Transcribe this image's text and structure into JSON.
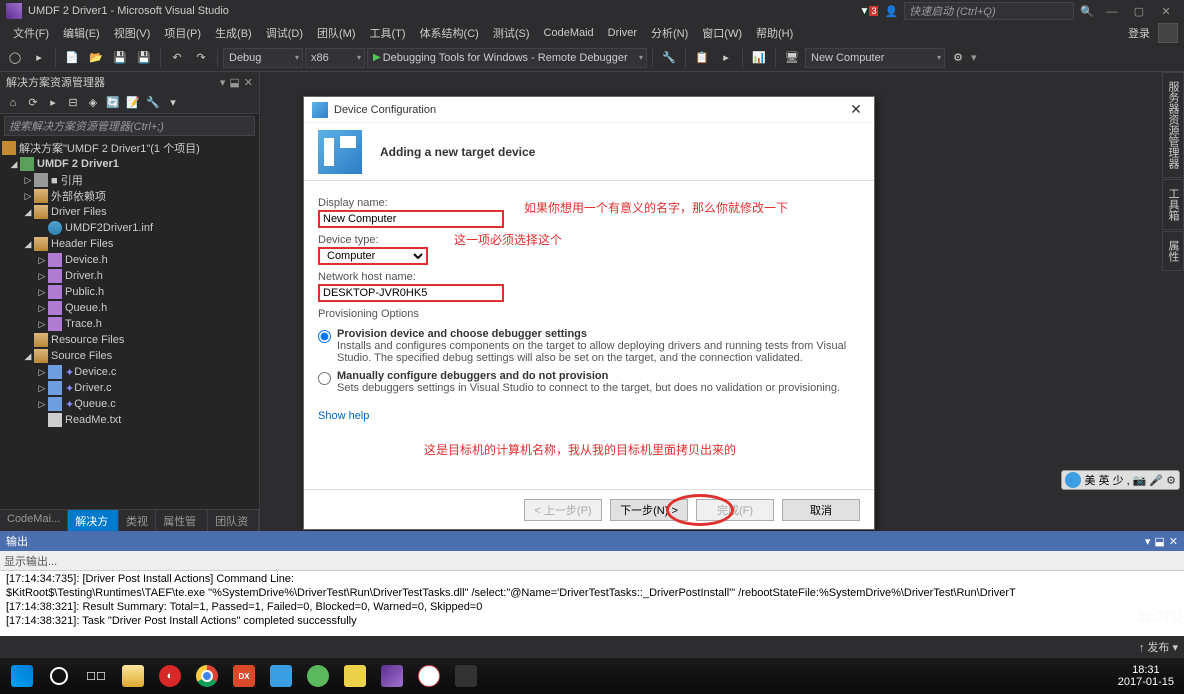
{
  "window": {
    "title": "UMDF 2 Driver1 - Microsoft Visual Studio",
    "quick_launch": "快速启动 (Ctrl+Q)",
    "login": "登录",
    "notif": "3"
  },
  "menu": [
    "文件(F)",
    "编辑(E)",
    "视图(V)",
    "项目(P)",
    "生成(B)",
    "调试(D)",
    "团队(M)",
    "工具(T)",
    "体系结构(C)",
    "测试(S)",
    "CodeMaid",
    "Driver",
    "分析(N)",
    "窗口(W)",
    "帮助(H)"
  ],
  "toolbar": {
    "config": "Debug",
    "platform": "x86",
    "debugger": "Debugging Tools for Windows - Remote Debugger",
    "target": "New Computer"
  },
  "solution_explorer": {
    "title": "解决方案资源管理器",
    "search": "搜索解决方案资源管理器(Ctrl+;)",
    "root": "解决方案\"UMDF 2 Driver1\"(1 个项目)"
  },
  "tree": {
    "project": "UMDF 2 Driver1",
    "refs": "■ 引用",
    "ext_deps": "外部依赖项",
    "driver_files": "Driver Files",
    "inf": "UMDF2Driver1.inf",
    "header_files": "Header Files",
    "device_h": "Device.h",
    "driver_h": "Driver.h",
    "public_h": "Public.h",
    "queue_h": "Queue.h",
    "trace_h": "Trace.h",
    "resource_files": "Resource Files",
    "source_files": "Source Files",
    "device_c": "Device.c",
    "driver_c": "Driver.c",
    "queue_c": "Queue.c",
    "readme": "ReadMe.txt"
  },
  "side_tabs": [
    "CodeMai...",
    "解决方案...",
    "类视图",
    "属性管理器",
    "团队资源..."
  ],
  "right_tabs": [
    "服务器资源管理器",
    "工具箱",
    "属性"
  ],
  "dialog": {
    "title": "Device Configuration",
    "heading": "Adding a new target device",
    "display_name_label": "Display name:",
    "display_name": "New Computer",
    "device_type_label": "Device type:",
    "device_type": "Computer",
    "host_label": "Network host name:",
    "host": "DESKTOP-JVR0HK5",
    "prov_label": "Provisioning Options",
    "opt1_title": "Provision device and choose debugger settings",
    "opt1_desc": "Installs and configures components on the target to allow deploying drivers and running tests from Visual Studio. The specified debug settings will also be set on the target, and the connection validated.",
    "opt2_title": "Manually configure debuggers and do not provision",
    "opt2_desc": "Sets debuggers settings in Visual Studio to connect to the target, but does no validation or provisioning.",
    "help": "Show help",
    "back": "< 上一步(P)",
    "next": "下一步(N) >",
    "finish": "完成(F)",
    "cancel": "取消"
  },
  "annotations": {
    "a1": "如果你想用一个有意义的名字，那么你就修改一下",
    "a2": "这一项必须选择这个",
    "a3": "这是目标机的计算机名称，我从我的目标机里面拷贝出来的"
  },
  "output": {
    "title": "输出",
    "from": "显示输出...",
    "l1": "[17:14:34:735]: [Driver Post Install Actions] Command Line:",
    "l2": "$KitRoot$\\Testing\\Runtimes\\TAEF\\te.exe \"%SystemDrive%\\DriverTest\\Run\\DriverTestTasks.dll\" /select:\"@Name='DriverTestTasks::_DriverPostInstall'\" /rebootStateFile:%SystemDrive%\\DriverTest\\Run\\DriverT",
    "l3": "[17:14:38:321]: Result Summary: Total=1, Passed=1, Failed=0, Blocked=0, Warned=0, Skipped=0",
    "l4": "[17:14:38:321]: Task \"Driver Post Install Actions\" completed successfully"
  },
  "status": "↑ 发布 ▾",
  "clock": {
    "time": "18:31",
    "date": "2017-01-15"
  },
  "floating": "美 英 少 ,",
  "watermark": "51CTO"
}
